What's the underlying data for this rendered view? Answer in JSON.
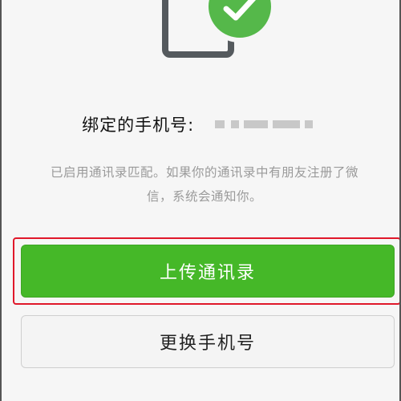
{
  "status": {
    "bound_phone_label": "绑定的手机号:",
    "phone_number_masked": true
  },
  "info": {
    "line1": "已启用通讯录匹配。如果你的通讯录中有朋友注册了微",
    "line2": "信，系统会通知你。"
  },
  "buttons": {
    "upload_contacts": "上传通讯录",
    "change_phone": "更换手机号"
  },
  "colors": {
    "accent_green": "#45b828",
    "check_green": "#55b84a",
    "highlight_red": "#e0182a",
    "muted_text": "#9a9a9a"
  },
  "icons": {
    "illustration": "phone-icon",
    "badge": "check-icon"
  }
}
